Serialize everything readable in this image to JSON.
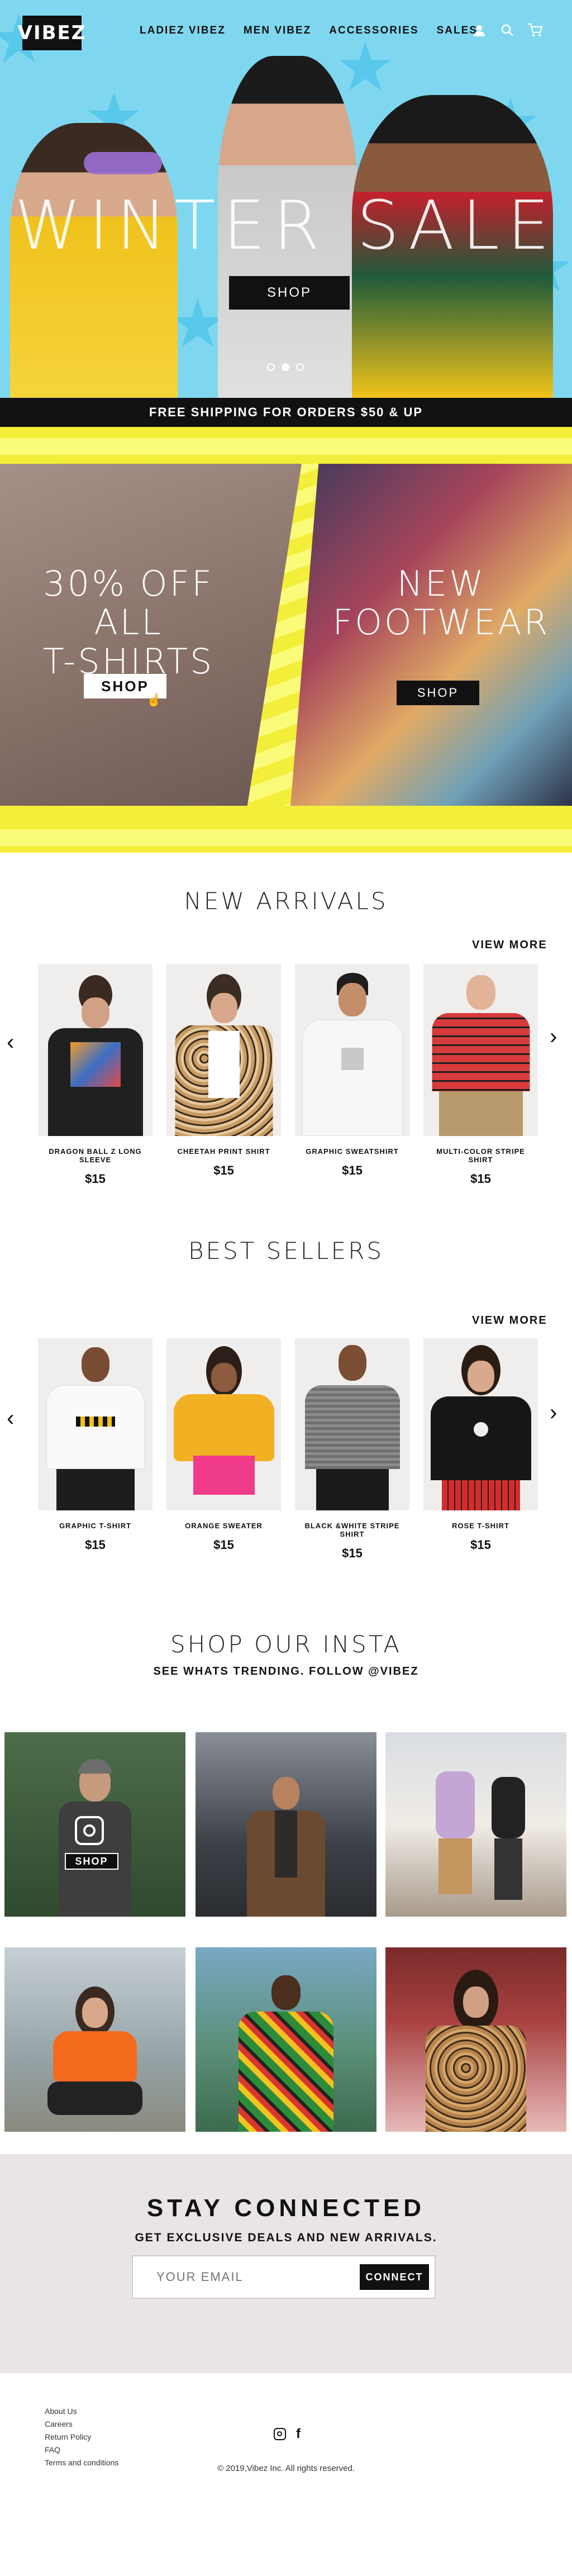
{
  "brand": {
    "logo_text": "VIBEZ"
  },
  "nav": {
    "items": [
      "LADIEZ VIBEZ",
      "MEN VIBEZ",
      "ACCESSORIES",
      "SALES"
    ],
    "icons": [
      "user-icon",
      "search-icon",
      "cart-icon"
    ]
  },
  "hero": {
    "headline": "WINTER SALE",
    "button": "SHOP",
    "slides": 3,
    "active_slide": 2
  },
  "shipping_bar": "FREE SHIPPING FOR ORDERS $50 & UP",
  "promo": {
    "left": {
      "title_line1": "30% OFF ALL",
      "title_line2": "T-SHIRTS",
      "button": "SHOP"
    },
    "right": {
      "title_line1": "NEW",
      "title_line2": "FOOTWEAR",
      "button": "SHOP"
    }
  },
  "new_arrivals": {
    "title": "NEW ARRIVALS",
    "view_more": "VIEW MORE",
    "products": [
      {
        "name": "DRAGON BALL Z LONG SLEEVE",
        "price": "$15"
      },
      {
        "name": "CHEETAH PRINT SHIRT",
        "price": "$15"
      },
      {
        "name": "GRAPHIC SWEATSHIRT",
        "price": "$15"
      },
      {
        "name": "MULTI-COLOR STRIPE SHIRT",
        "price": "$15"
      }
    ]
  },
  "best_sellers": {
    "title": "BEST SELLERS",
    "view_more": "VIEW MORE",
    "products": [
      {
        "name": "GRAPHIC T-SHIRT",
        "price": "$15"
      },
      {
        "name": "ORANGE SWEATER",
        "price": "$15"
      },
      {
        "name": "BLACK &WHITE STRIPE SHIRT",
        "price": "$15"
      },
      {
        "name": "ROSE T-SHIRT",
        "price": "$15"
      }
    ]
  },
  "insta": {
    "title": "SHOP OUR INSTA",
    "subtitle": "SEE WHATS TRENDING. FOLLOW @VIBEZ",
    "overlay_button": "SHOP"
  },
  "newsletter": {
    "title": "STAY CONNECTED",
    "subtitle": "GET EXCLUSIVE DEALS AND NEW ARRIVALS.",
    "placeholder": "YOUR EMAIL",
    "button": "CONNECT"
  },
  "footer": {
    "links": [
      "About Us",
      "Careers",
      "Return Policy",
      "FAQ",
      "Terms and conditions"
    ],
    "copyright": "© 2019,Vibez Inc. All rights reserved.",
    "social_icons": [
      "instagram-icon",
      "facebook-icon"
    ]
  },
  "colors": {
    "hero_bg": "#7fd7ef",
    "promo_yellow": "#f2ee3a",
    "newsletter_bg": "#e9e5e4",
    "black": "#111111"
  }
}
